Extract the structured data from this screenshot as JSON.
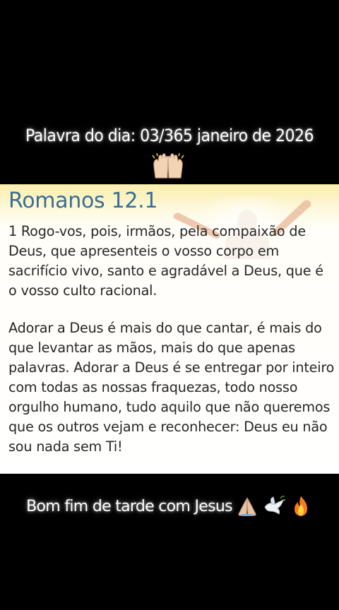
{
  "header": {
    "caption": "Palavra do dia: 03/365 janeiro de 2026",
    "caption_icon": "raising-hands-icon"
  },
  "card": {
    "title": "Romanos 12.1",
    "verse": "1 Rogo-vos, pois, irmãos, pela compaixão de Deus, que apresenteis o vosso corpo em sacrifício vivo, santo e agradável a Deus, que é o vosso culto racional.",
    "reflection": "Adorar a Deus é mais do que cantar, é mais do que levantar as mãos, mais do que apenas palavras. Adorar a Deus é se entregar por inteiro com todas as nossas fraquezas, todo nosso orgulho humano, tudo aquilo que não queremos que os outros vejam e reconhecer: Deus eu não sou nada sem Ti!",
    "title_color": "#3a6d93",
    "background_image_icon": "person-raised-arms-icon"
  },
  "footer": {
    "caption": "Bom fim de tarde com Jesus",
    "icons": [
      "praying-hands-icon",
      "dove-icon",
      "fire-icon"
    ]
  }
}
